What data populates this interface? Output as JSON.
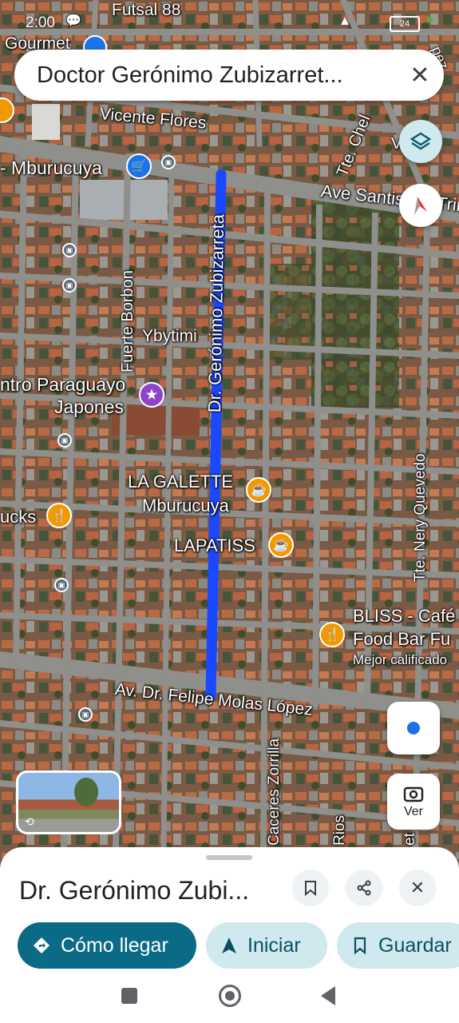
{
  "status_bar": {
    "time": "2:00",
    "battery": "24"
  },
  "search": {
    "query": "Doctor Gerónimo Zubizarret...",
    "close_icon": "close-icon"
  },
  "map": {
    "street_labels": {
      "futsal": "Futsal 88",
      "gourmet": "Gourmet",
      "vicente_flores": "Vicente Flores",
      "mburucuya": "- Mburucuya",
      "ave_santisima": "Ave Santisima Trin",
      "tte_chel": "Tte. Chel",
      "vic_flo": "Vic Flo",
      "pez": "pez",
      "fuerte_borbon": "Fuerte Borbon",
      "ybytimi": "Ybytimi",
      "zubizarreta": "Dr. Gerónimo Zubizarreta",
      "centro_paraguayo": "ntro Paraguayo",
      "japones": "Japones",
      "nery_quevedo": "Tte. Nery Quevedo",
      "felipe_molas": "Av. Dr. Felipe Molas López",
      "caceres_zorrilla": "Caceres Zorrilla",
      "rios": "Rios",
      "et": "et"
    },
    "pois": {
      "la_galette_1": "LA GALETTE",
      "la_galette_2": "Mburucuya",
      "lapatiss": "LAPATISS",
      "bliss_1": "BLISS - Café",
      "bliss_2": "Food Bar Fu",
      "bliss_sub": "Mejor calificado",
      "starbucks": "ucks"
    },
    "route_color": "#1a48ff"
  },
  "controls": {
    "ver_label": "Ver"
  },
  "place": {
    "title": "Dr. Gerónimo Zubi...",
    "actions": {
      "directions": "Cómo llegar",
      "start": "Iniciar",
      "save": "Guardar"
    },
    "accent": "#0b6b87"
  }
}
